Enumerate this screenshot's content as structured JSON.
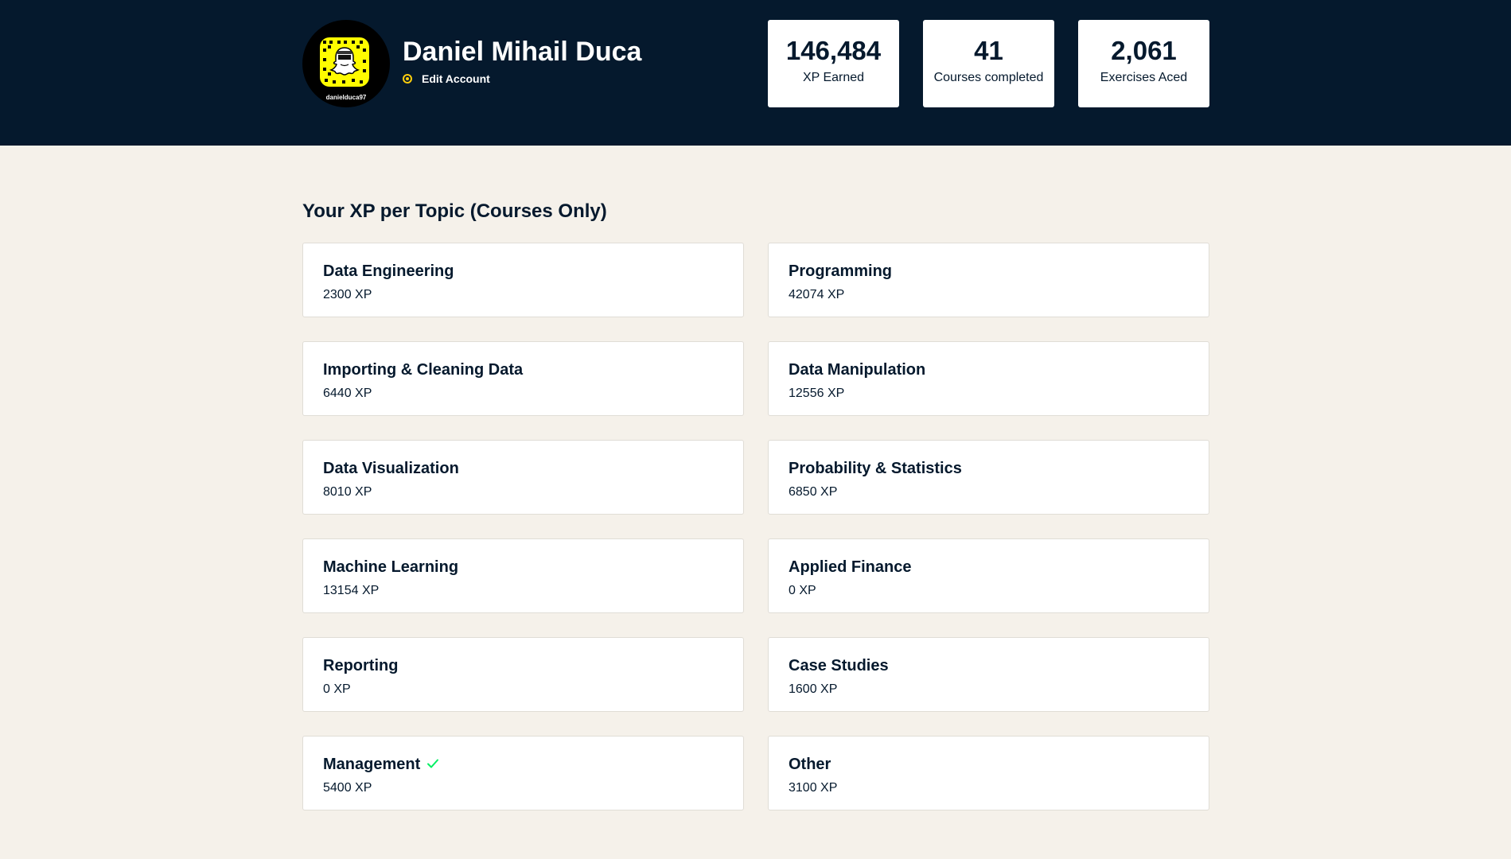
{
  "profile": {
    "name": "Daniel Mihail Duca",
    "edit_label": "Edit Account",
    "avatar_handle": "danielduca97",
    "avatar_icon": "snapcode-icon",
    "edit_icon": "gear-icon"
  },
  "stats": [
    {
      "value": "146,484",
      "label": "XP Earned"
    },
    {
      "value": "41",
      "label": "Courses completed"
    },
    {
      "value": "2,061",
      "label": "Exercises Aced"
    }
  ],
  "section": {
    "title": "Your XP per Topic (Courses Only)"
  },
  "topics": [
    {
      "name": "Data Engineering",
      "xp": "2300 XP"
    },
    {
      "name": "Programming",
      "xp": "42074 XP"
    },
    {
      "name": "Importing & Cleaning Data",
      "xp": "6440 XP"
    },
    {
      "name": "Data Manipulation",
      "xp": "12556 XP"
    },
    {
      "name": "Data Visualization",
      "xp": "8010 XP"
    },
    {
      "name": "Probability & Statistics",
      "xp": "6850 XP"
    },
    {
      "name": "Machine Learning",
      "xp": "13154 XP"
    },
    {
      "name": "Applied Finance",
      "xp": "0 XP"
    },
    {
      "name": "Reporting",
      "xp": "0 XP"
    },
    {
      "name": "Case Studies",
      "xp": "1600 XP"
    },
    {
      "name": "Management",
      "xp": "5400 XP",
      "completed": true
    },
    {
      "name": "Other",
      "xp": "3100 XP"
    }
  ],
  "colors": {
    "header_bg": "#05192d",
    "page_bg": "#f5f1ea",
    "accent_yellow": "#fcce0d",
    "check_green": "#03ef62"
  }
}
